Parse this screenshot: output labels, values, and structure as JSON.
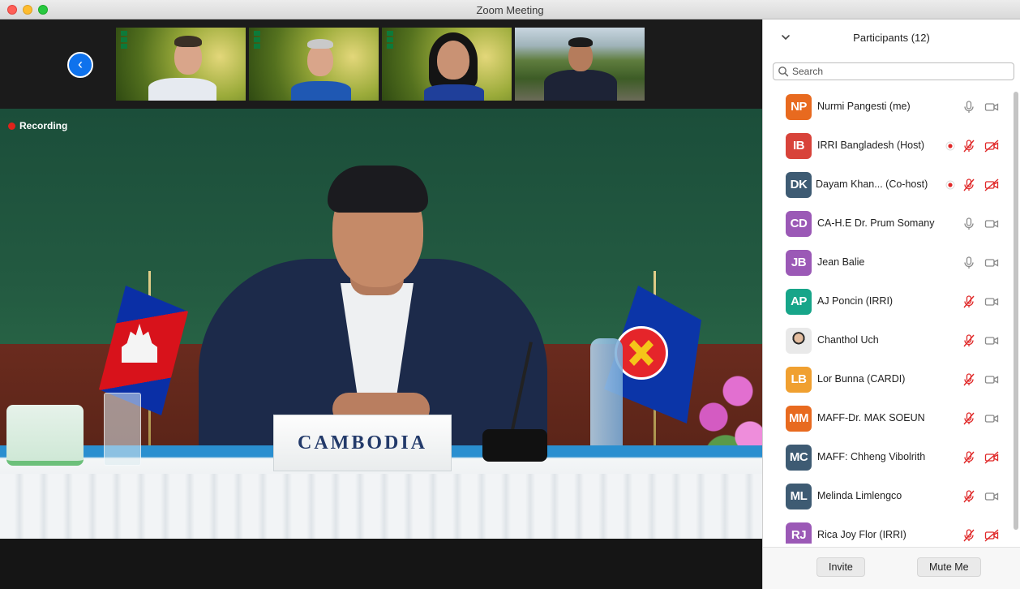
{
  "window": {
    "title": "Zoom Meeting"
  },
  "recording": {
    "label": "Recording"
  },
  "nameplate": {
    "text": "CAMBODIA"
  },
  "panel": {
    "title": "Participants (12)",
    "search_placeholder": "Search",
    "invite_label": "Invite",
    "mute_me_label": "Mute Me"
  },
  "participants": [
    {
      "initials": "NP",
      "name": "Nurmi Pangesti (me)",
      "color": "#e86a1f",
      "recording": false,
      "mic": "on",
      "video": "on"
    },
    {
      "initials": "IB",
      "name": "IRRI Bangladesh (Host)",
      "color": "#d8433a",
      "recording": true,
      "mic": "muted",
      "video": "off"
    },
    {
      "initials": "DK",
      "name": "Dayam Khan...  (Co-host)",
      "color": "#3e5b73",
      "recording": true,
      "mic": "muted",
      "video": "off"
    },
    {
      "initials": "CD",
      "name": "CA-H.E Dr. Prum Somany",
      "color": "#9b59b6",
      "recording": false,
      "mic": "on",
      "video": "on"
    },
    {
      "initials": "JB",
      "name": "Jean Balie",
      "color": "#9b59b6",
      "recording": false,
      "mic": "on",
      "video": "on"
    },
    {
      "initials": "AP",
      "name": "AJ Poncin (IRRI)",
      "color": "#17a589",
      "recording": false,
      "mic": "muted",
      "video": "on"
    },
    {
      "initials": "",
      "name": "Chanthol Uch",
      "color": "#e9e9e9",
      "photo": true,
      "recording": false,
      "mic": "muted",
      "video": "on"
    },
    {
      "initials": "LB",
      "name": "Lor Bunna (CARDI)",
      "color": "#f0a030",
      "recording": false,
      "mic": "muted",
      "video": "on"
    },
    {
      "initials": "MM",
      "name": "MAFF-Dr. MAK SOEUN",
      "color": "#e86a1f",
      "recording": false,
      "mic": "muted",
      "video": "on"
    },
    {
      "initials": "MC",
      "name": "MAFF: Chheng Vibolrith",
      "color": "#3e5b73",
      "recording": false,
      "mic": "muted",
      "video": "off"
    },
    {
      "initials": "ML",
      "name": "Melinda Limlengco",
      "color": "#3e5b73",
      "recording": false,
      "mic": "muted",
      "video": "on"
    },
    {
      "initials": "RJ",
      "name": "Rica Joy Flor (IRRI)",
      "color": "#9b59b6",
      "recording": false,
      "mic": "muted",
      "video": "off"
    }
  ],
  "colors": {
    "accent": "#0e72ed",
    "muted_red": "#e02828",
    "icon_gray": "#8a8a8a"
  }
}
